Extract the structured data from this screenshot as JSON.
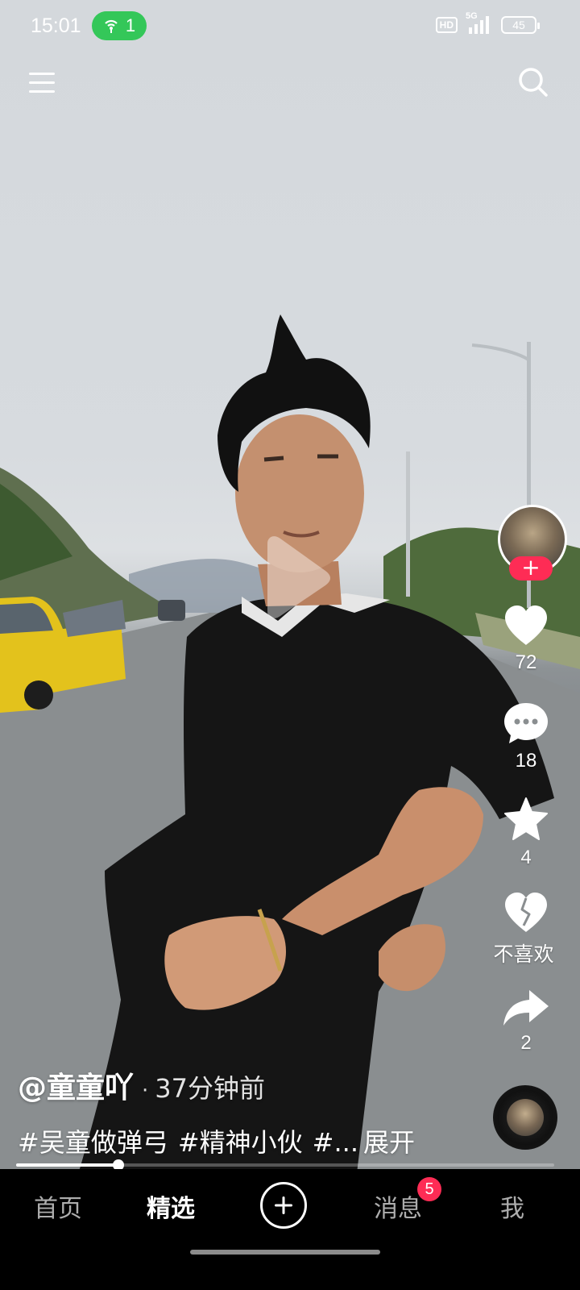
{
  "status_bar": {
    "time": "15:01",
    "hotspot_count": "1",
    "network_label": "HD",
    "signal_label": "5G",
    "battery_level": "45"
  },
  "toolbar": {
    "menu_icon": "menu-icon",
    "search_icon": "search-icon"
  },
  "video": {
    "play_icon": "play-icon",
    "progress_fraction": 0.19
  },
  "actions": {
    "follow_label": "+",
    "likes": "72",
    "comments": "18",
    "favorites": "4",
    "dislike_label": "不喜欢",
    "shares": "2"
  },
  "caption": {
    "author": "@童童吖",
    "separator": "·",
    "posted": "37分钟前",
    "hashtags": [
      "#吴童做弹弓",
      "#精神小伙",
      "#..."
    ],
    "expand_label": "展开"
  },
  "bottom_nav": {
    "tabs": [
      "首页",
      "精选",
      "消息",
      "我"
    ],
    "active_tab": "精选",
    "messages_badge": "5"
  },
  "colors": {
    "accent": "#fe2c55",
    "hotspot_green": "#34c759",
    "nav_background": "#000000"
  }
}
